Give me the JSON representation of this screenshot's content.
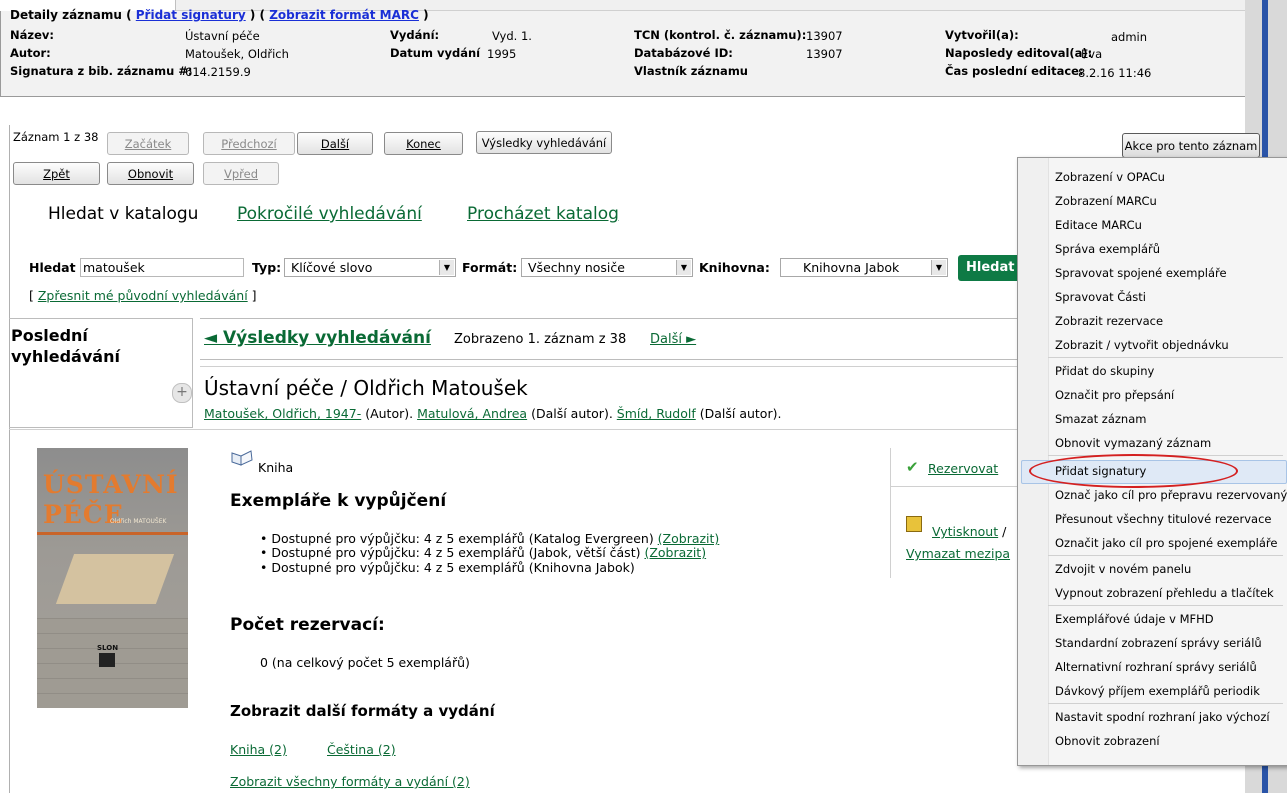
{
  "details": {
    "caption_prefix": "Detaily záznamu  ( ",
    "add_callnumbers_link": "Přidat signatury",
    "caption_mid": " ) ( ",
    "marc_link": "Zobrazit formát MARC",
    "caption_suffix": " )",
    "fields": {
      "nazev_label": "Název:",
      "nazev": "Ústavní péče",
      "autor_label": "Autor:",
      "autor": "Matoušek, Oldřich",
      "sig_label": "Signatura z bib. záznamu #:",
      "sig": "614.2159.9",
      "vydani_label": "Vydání:",
      "vydani": "Vyd. 1.",
      "datum_label": "Datum vydání",
      "datum": "1995",
      "tcn_label": "TCN (kontrol. č. záznamu):",
      "tcn": "13907",
      "dbid_label": "Databázové ID:",
      "dbid": "13907",
      "vlastnik_label": "Vlastník záznamu",
      "vytvoril_label": "Vytvořil(a):",
      "vytvoril": "admin",
      "edit_label": "Naposledy editoval(a):",
      "edit": "Eva",
      "cas_label": "Čas poslední editace:",
      "cas": "8.2.16 11:46"
    }
  },
  "toolbar": {
    "record_pos": "Záznam 1 z 38",
    "zacatek": "Začátek",
    "predchozi": "Předchozí",
    "dalsi": "Další",
    "konec": "Konec",
    "vysledky": "Výsledky vyhledávání",
    "zpet": "Zpět",
    "obnovit": "Obnovit",
    "vpred": "Vpřed",
    "akce": "Akce pro tento záznam"
  },
  "search": {
    "tab_hledat": "Hledat v katalogu",
    "tab_pokrocile": "Pokročilé vyhledávání",
    "tab_prochazet": "Procházet katalog",
    "hledat_label": "Hledat",
    "query": "matoušek",
    "typ_label": "Typ:",
    "typ_value": "Klíčové slovo",
    "format_label": "Formát:",
    "format_value": "Všechny nosiče",
    "knihovna_label": "Knihovna:",
    "knihovna_value": "Knihovna Jabok",
    "hledat_button": "Hledat",
    "refine_link": "Zpřesnit mé původní vyhledávání",
    "refine_open": "[ ",
    "refine_close": " ]"
  },
  "results": {
    "last_searches_line1": "Poslední",
    "last_searches_line2": "vyhledávání",
    "expander": "+",
    "back_link": "◄ Výsledky vyhledávání",
    "shown": "Zobrazeno 1. záznam z 38",
    "next": "Další ►",
    "title": "Ústavní péče / Oldřich Matoušek",
    "author1": "Matoušek, Oldřich, 1947-",
    "author1_role": " (Autor). ",
    "author2": "Matulová, Andrea",
    "author2_role": " (Další autor). ",
    "author3": "Šmíd, Rudolf",
    "author3_role": " (Další autor).",
    "format": "Kniha",
    "copies_heading": "Exempláře k vypůjčení",
    "copies": [
      {
        "text": "Dostupné pro výpůjčku: 4 z 5 exemplářů (Katalog Evergreen) ",
        "link": "(Zobrazit)"
      },
      {
        "text": "Dostupné pro výpůjčku: 4 z 5 exemplářů (Jabok, větší část) ",
        "link": "(Zobrazit)"
      },
      {
        "text": "Dostupné pro výpůjčku: 4 z 5 exemplářů (Knihovna Jabok)",
        "link": ""
      }
    ],
    "holds_heading": "Počet rezervací:",
    "holds_value": "0 (na celkový počet 5 exemplářů)",
    "other_formats_heading": "Zobrazit další formáty a vydání",
    "fmt_kniha": "Kniha (2)",
    "fmt_cestina": "Čeština (2)",
    "all_formats": "Zobrazit všechny formáty a vydání (2)",
    "rezervovat": "Rezervovat",
    "vytisknout": "Vytisknout",
    "vytisknout_suffix": " /",
    "vymazat": "Vymazat mezipa",
    "cover": {
      "title1": "ÚSTAVNÍ",
      "title2": "PÉČE",
      "author": "Oldřich MATOUŠEK",
      "publisher": "SLON"
    }
  },
  "menu": {
    "items": [
      "Zobrazení v OPACu",
      "Zobrazení MARCu",
      "Editace MARCu",
      "Správa exemplářů",
      "Spravovat spojené exempláře",
      "Spravovat Části",
      "Zobrazit rezervace",
      "Zobrazit / vytvořit objednávku",
      "Přidat do skupiny",
      "Označit pro přepsání",
      "Smazat záznam",
      "Obnovit vymazaný záznam",
      "Přidat signatury",
      "Označ jako cíl pro přepravu rezervovaných",
      "Přesunout všechny titulové rezervace",
      "Označit jako cíl pro spojené exempláře",
      "Zdvojit v novém panelu",
      "Vypnout zobrazení přehledu  a tlačítek",
      "Exemplářové údaje v MFHD",
      "Standardní zobrazení správy seriálů",
      "Alternativní rozhraní správy seriálů",
      "Dávkový příjem exemplářů periodik",
      "Nastavit spodní rozhraní jako výchozí",
      "Obnovit zobrazení"
    ]
  },
  "colors": {
    "link_green": "#0a6a35",
    "link_blue": "#1a2fd6",
    "hledat_button": "#0e7a45",
    "highlight_ring": "#d42020"
  }
}
